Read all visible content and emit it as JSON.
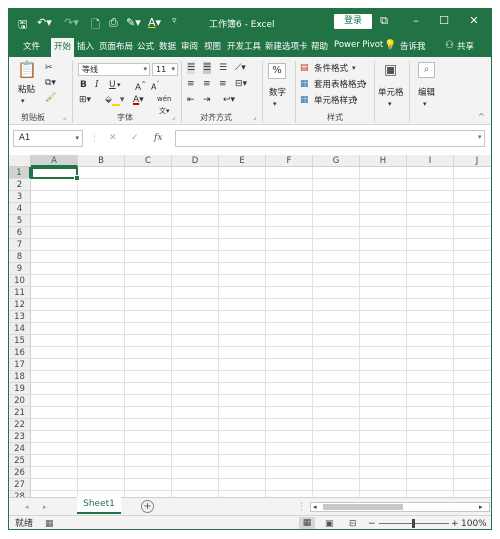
{
  "window": {
    "title": "工作簿6 - Excel",
    "login_label": "登录",
    "icons": [
      "save-icon",
      "undo-icon",
      "redo-icon",
      "new-file-icon",
      "print-preview-icon",
      "format-painter-icon",
      "font-color-icon",
      "customize-qat-icon"
    ]
  },
  "tabs": [
    "文件",
    "开始",
    "插入",
    "页面布局",
    "公式",
    "数据",
    "审阅",
    "视图",
    "开发工具",
    "新建选项卡",
    "帮助",
    "Power Pivot"
  ],
  "active_tab": "开始",
  "tell_me": "告诉我",
  "share": "共享",
  "ribbon": {
    "clipboard": {
      "paste": "粘贴",
      "group": "剪贴板"
    },
    "font": {
      "name": "等线",
      "size": "11",
      "bold": "B",
      "italic": "I",
      "underline": "U",
      "group": "字体"
    },
    "alignment": {
      "group": "对齐方式"
    },
    "number": {
      "label": "数字"
    },
    "styles": {
      "conditional": "条件格式",
      "table": "套用表格格式",
      "cell": "单元格样式",
      "group": "样式"
    },
    "cells": {
      "label": "单元格"
    },
    "editing": {
      "label": "编辑"
    }
  },
  "formula_bar": {
    "name_box": "A1",
    "fx": "fx",
    "value": ""
  },
  "grid": {
    "columns": [
      "A",
      "B",
      "C",
      "D",
      "E",
      "F",
      "G",
      "H",
      "I",
      "J"
    ],
    "rows": [
      "1",
      "2",
      "3",
      "4",
      "5",
      "6",
      "7",
      "8",
      "9",
      "10",
      "11",
      "12",
      "13",
      "14",
      "15",
      "16",
      "17",
      "18",
      "19",
      "20",
      "21",
      "22",
      "23",
      "24",
      "25",
      "26",
      "27",
      "28"
    ],
    "active_cell": "A1"
  },
  "sheets": [
    "Sheet1"
  ],
  "status": {
    "mode": "就绪",
    "zoom": "100%"
  }
}
